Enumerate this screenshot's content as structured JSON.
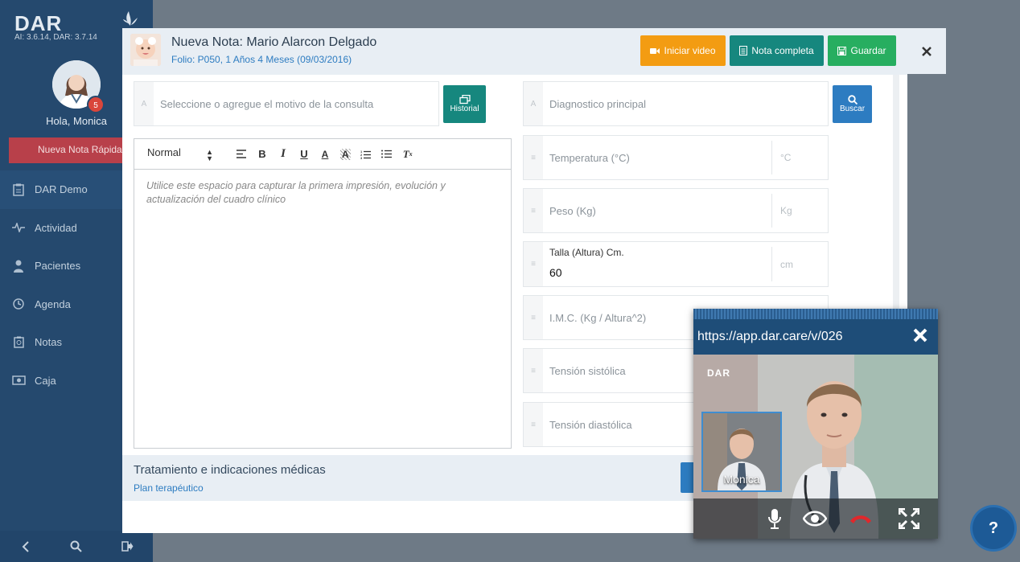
{
  "sidebar": {
    "logo": "DAR",
    "versions": "AI: 3.6.14, DAR: 3.7.14",
    "badge_count": "5",
    "greeting": "Hola, Monica",
    "quick_note": "Nueva Nota Rápida",
    "items": [
      {
        "label": "DAR Demo",
        "icon": "clipboard-icon"
      },
      {
        "label": "Actividad",
        "icon": "pulse-icon"
      },
      {
        "label": "Pacientes",
        "icon": "user-icon"
      },
      {
        "label": "Agenda",
        "icon": "clock-icon"
      },
      {
        "label": "Notas",
        "icon": "notes-icon"
      },
      {
        "label": "Caja",
        "icon": "cash-icon"
      }
    ],
    "bottom_icons": [
      "chevron-left-icon",
      "search-icon",
      "logout-icon"
    ]
  },
  "header": {
    "title": "Nueva Nota: Mario Alarcon Delgado",
    "folio": "Folio: P050, 1 Años 4 Meses (09/03/2016)",
    "btn_video": "Iniciar video",
    "btn_nota": "Nota completa",
    "btn_save": "Guardar"
  },
  "form": {
    "motivo_placeholder": "Seleccione o agregue el motivo de la consulta",
    "historial_label": "Historial",
    "diagnostico_placeholder": "Diagnostico principal",
    "buscar_label": "Buscar",
    "temperatura": {
      "label": "Temperatura (°C)",
      "unit": "°C"
    },
    "peso": {
      "label": "Peso (Kg)",
      "unit": "Kg"
    },
    "talla": {
      "label": "Talla (Altura) Cm.",
      "value": "60",
      "unit": "cm"
    },
    "imc": {
      "label": "I.M.C. (Kg / Altura^2)"
    },
    "sistolica": {
      "label": "Tensión sistólica"
    },
    "diastolica": {
      "label": "Tensión diastólica"
    }
  },
  "editor": {
    "format": "Normal",
    "placeholder": "Utilice este espacio para capturar la primera impresión, evolución y actualización del cuadro clínico"
  },
  "treatment": {
    "title": "Tratamiento e indicaciones médicas",
    "subtitle": "Plan terapéutico"
  },
  "video": {
    "url": "https://app.dar.care/v/026",
    "brand": "DAR",
    "pip_name": "Monica"
  },
  "help": "?",
  "colors": {
    "sidebar": "#25496e",
    "video_btn": "#f39c12",
    "nota_btn": "#16877e",
    "save_btn": "#27ae60",
    "quick_note": "#b8404a",
    "link": "#2d7cc1"
  }
}
